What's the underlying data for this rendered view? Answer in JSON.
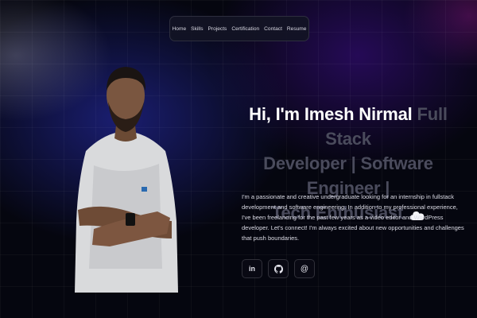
{
  "nav": {
    "items": [
      "Home",
      "Skills",
      "Projects",
      "Certification",
      "Contact",
      "Resume"
    ]
  },
  "hero": {
    "greeting": "Hi, I'm Imesh Nirmal",
    "role_line_1": "Full Stack",
    "role_line_2": "Developer | Software Engineer |",
    "role_line_3": "Tech Enthusiast",
    "bio": "I'm a passionate and creative undergraduate looking for an internship in fullstack development and software engineering. In addition to my professional experience, I've been freelancing for the past few years as a video editor and WordPress developer. Let's connect! I'm always excited about new opportunities and challenges that push boundaries."
  },
  "socials": {
    "icons": [
      "linkedin-icon",
      "github-icon",
      "email-icon"
    ],
    "linkedin_glyph": "in",
    "email_glyph": "@"
  },
  "colors": {
    "background": "#05060f",
    "name_text": "#ffffff",
    "role_text": "#4a4b5c",
    "glow_blue": "#1e2282",
    "glow_purple": "#300c6e"
  }
}
